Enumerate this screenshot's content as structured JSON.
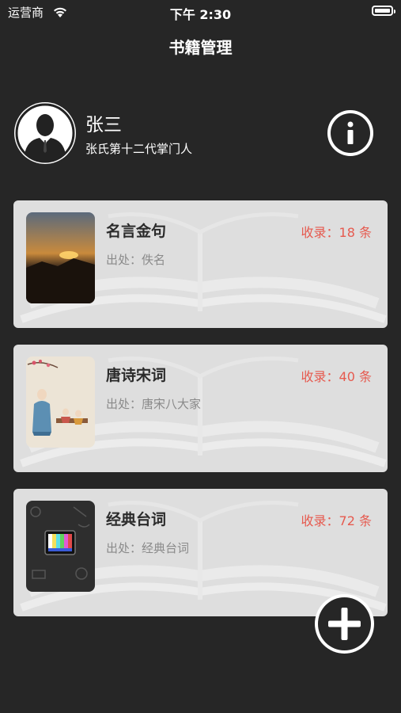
{
  "status_bar": {
    "carrier": "运营商",
    "time": "下午 2:30"
  },
  "nav": {
    "title": "书籍管理"
  },
  "profile": {
    "name": "张三",
    "title": "张氏第十二代掌门人"
  },
  "books": [
    {
      "title": "名言金句",
      "count": "收录：18 条",
      "source": "出处：佚名",
      "cover": "sunset-photo"
    },
    {
      "title": "唐诗宋词",
      "count": "收录：40 条",
      "source": "出处：唐宋八大家",
      "cover": "ancient-scholars-painting"
    },
    {
      "title": "经典台词",
      "count": "收录：72 条",
      "source": "出处：经典台词",
      "cover": "tv-test-pattern-doodle"
    }
  ],
  "icons": {
    "info": "info-icon",
    "add": "plus-icon",
    "wifi": "wifi-icon",
    "battery": "battery-icon",
    "avatar": "user-silhouette-icon"
  },
  "colors": {
    "background": "#262626",
    "card": "#dedede",
    "count_accent": "#e65a4f",
    "title_text": "#2b2b2b",
    "source_text": "#8a8a8a"
  }
}
